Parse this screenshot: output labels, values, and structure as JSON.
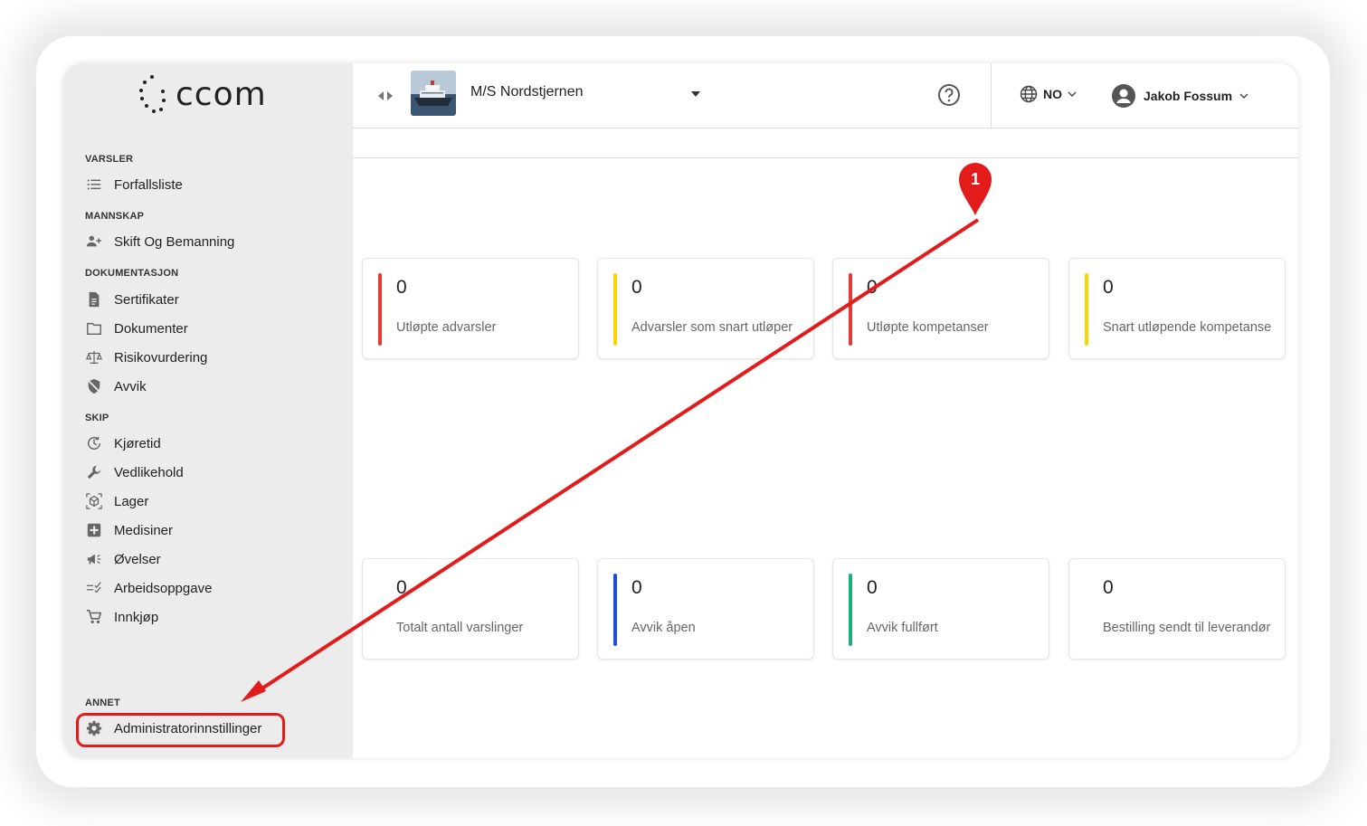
{
  "app": {
    "logo_text": "ccom"
  },
  "sidebar": {
    "sections": [
      {
        "title": "VARSLER",
        "items": [
          {
            "label": "Forfallsliste",
            "icon": "list-icon"
          }
        ]
      },
      {
        "title": "MANNSKAP",
        "items": [
          {
            "label": "Skift Og Bemanning",
            "icon": "add-user-icon"
          }
        ]
      },
      {
        "title": "DOKUMENTASJON",
        "items": [
          {
            "label": "Sertifikater",
            "icon": "document-icon"
          },
          {
            "label": "Dokumenter",
            "icon": "folder-icon"
          },
          {
            "label": "Risikovurdering",
            "icon": "scale-icon"
          },
          {
            "label": "Avvik",
            "icon": "shield-off-icon"
          }
        ]
      },
      {
        "title": "SKIP",
        "items": [
          {
            "label": "Kjøretid",
            "icon": "clock-icon"
          },
          {
            "label": "Vedlikehold",
            "icon": "wrench-icon"
          },
          {
            "label": "Lager",
            "icon": "warehouse-icon"
          },
          {
            "label": "Medisiner",
            "icon": "medical-icon"
          },
          {
            "label": "Øvelser",
            "icon": "megaphone-icon"
          },
          {
            "label": "Arbeidsoppgave",
            "icon": "checklist-icon"
          },
          {
            "label": "Innkjøp",
            "icon": "cart-icon"
          }
        ]
      },
      {
        "title": "ANNET",
        "items": [
          {
            "label": "Administratorinnstillinger",
            "icon": "gear-icon"
          }
        ]
      }
    ]
  },
  "topbar": {
    "vessel_name": "M/S Nordstjernen",
    "language": "NO",
    "user_name": "Jakob Fossum"
  },
  "cards": [
    {
      "value": "0",
      "label": "Utløpte advarsler",
      "color": "#e53935"
    },
    {
      "value": "0",
      "label": "Advarsler som snart utløper",
      "color": "#fdd400"
    },
    {
      "value": "0",
      "label": "Utløpte kompetanser",
      "color": "#e53935"
    },
    {
      "value": "0",
      "label": "Snart utløpende kompetanse",
      "color": "#fdd400"
    },
    {
      "value": "0",
      "label": "Totalt antall varslinger",
      "color": ""
    },
    {
      "value": "0",
      "label": "Avvik åpen",
      "color": "#1e4fd8"
    },
    {
      "value": "0",
      "label": "Avvik fullført",
      "color": "#1fae7a"
    },
    {
      "value": "0",
      "label": "Bestilling sendt til leverandør",
      "color": ""
    }
  ],
  "annotation": {
    "step_number": "1",
    "color": "#e31b1b"
  }
}
